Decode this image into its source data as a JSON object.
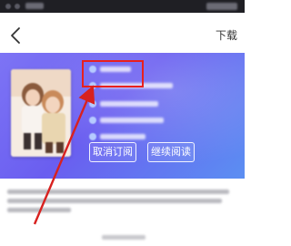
{
  "header": {
    "title": "",
    "download_label": "下载"
  },
  "actions": {
    "unsubscribe_label": "取消订阅",
    "continue_label": "继续阅读"
  },
  "colors": {
    "banner_start": "#7d74f5",
    "banner_end": "#5b8ff2",
    "highlight": "#e8201e",
    "arrow": "#d8211f",
    "title": "#7a6df0"
  },
  "icons": {
    "back": "chevron-left-icon"
  }
}
